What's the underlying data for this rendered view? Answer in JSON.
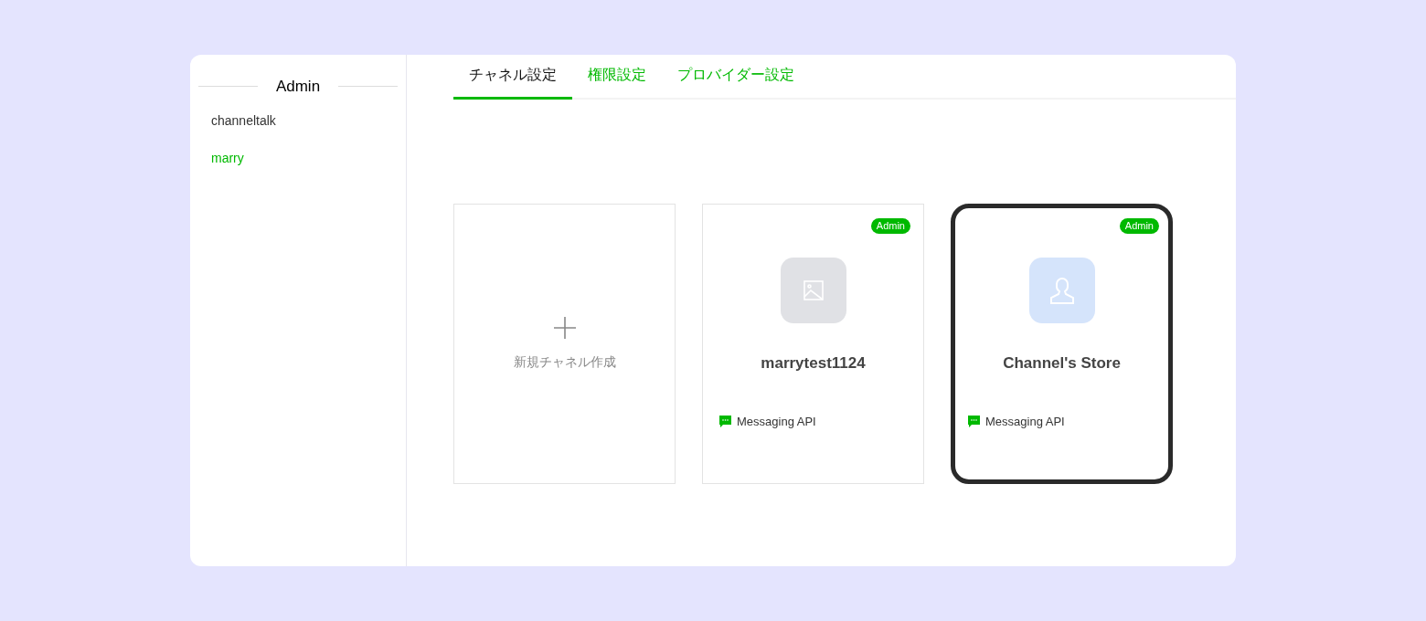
{
  "sidebar": {
    "title": "Admin",
    "items": [
      {
        "label": "channeltalk",
        "selected": false
      },
      {
        "label": "marry",
        "selected": true
      }
    ]
  },
  "tabs": [
    {
      "label": "チャネル設定",
      "selected": true
    },
    {
      "label": "権限設定",
      "selected": false
    },
    {
      "label": "プロバイダー設定",
      "selected": false
    }
  ],
  "cards": [
    {
      "kind": "create",
      "label": "新規チャネル作成"
    },
    {
      "kind": "channel",
      "badge": "Admin",
      "avatar": {
        "kind": "image"
      },
      "name": "marrytest1124",
      "type": "Messaging API",
      "selected": false
    },
    {
      "kind": "channel",
      "badge": "Admin",
      "avatar": {
        "kind": "person"
      },
      "name": "Channel's Store",
      "type": "Messaging API",
      "selected": true
    }
  ]
}
